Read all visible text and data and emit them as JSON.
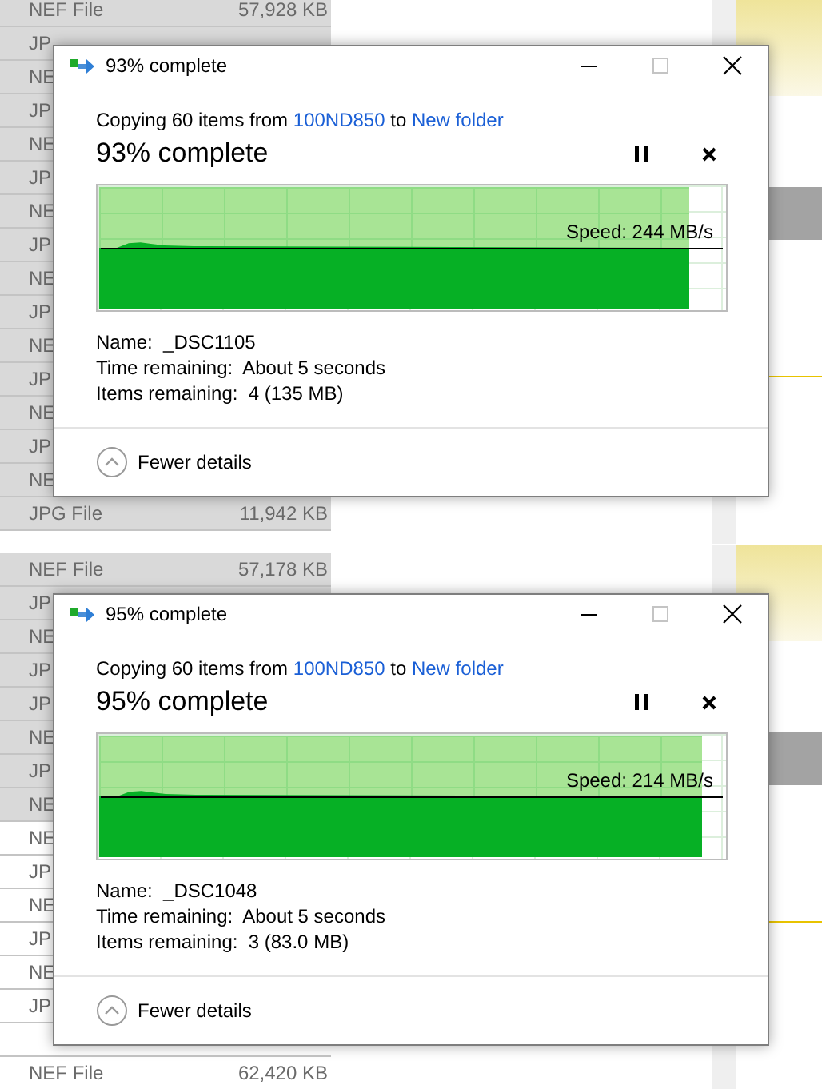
{
  "panels": [
    {
      "explorer": {
        "rows": [
          {
            "type": "NEF File",
            "size": "57,928 KB",
            "selected": true
          },
          {
            "type": "JP",
            "selected": true
          },
          {
            "type": "NE",
            "selected": true
          },
          {
            "type": "JP",
            "selected": true
          },
          {
            "type": "NE",
            "selected": true
          },
          {
            "type": "JP",
            "selected": true
          },
          {
            "type": "NE",
            "selected": true
          },
          {
            "type": "JP",
            "selected": true
          },
          {
            "type": "NE",
            "selected": true
          },
          {
            "type": "JP",
            "selected": true
          },
          {
            "type": "NE",
            "selected": true
          },
          {
            "type": "JP",
            "selected": true
          },
          {
            "type": "NE",
            "selected": true
          },
          {
            "type": "JP",
            "selected": true
          },
          {
            "type": "NE",
            "selected": true
          },
          {
            "type": "JPG File",
            "size": "11,942 KB",
            "selected": true
          }
        ]
      },
      "dialog": {
        "title": "93% complete",
        "message": {
          "prefix": "Copying 60 items from",
          "source": "100ND850",
          "middle": "to",
          "destination": "New folder"
        },
        "heading": "93% complete",
        "level": 0.94,
        "speed": "Speed: 244 MB/s",
        "details": [
          {
            "label": "Name:",
            "value": "_DSC1105"
          },
          {
            "label": "Time remaining:",
            "value": "About 5 seconds"
          },
          {
            "label": "Items remaining:",
            "value": "4 (135 MB)"
          }
        ],
        "toggle": "Fewer details"
      }
    },
    {
      "explorer": {
        "rows": [
          {
            "type": "NEF File",
            "size": "57,178 KB",
            "selected": true
          },
          {
            "type": "JP",
            "selected": true
          },
          {
            "type": "NE",
            "selected": true
          },
          {
            "type": "JP",
            "selected": true
          },
          {
            "type": "JP",
            "selected": true
          },
          {
            "type": "NE",
            "selected": true
          },
          {
            "type": "JP",
            "selected": true
          },
          {
            "type": "NE",
            "selected": true
          },
          {
            "type": "NE",
            "selected": false
          },
          {
            "type": "JP",
            "selected": false
          },
          {
            "type": "NE",
            "selected": false
          },
          {
            "type": "JP",
            "selected": false
          },
          {
            "type": "NE",
            "selected": false
          },
          {
            "type": "JP",
            "selected": false
          },
          {
            "selected": false
          },
          {
            "type": "NEF File",
            "size": "62,420 KB",
            "selected": false
          }
        ]
      },
      "dialog": {
        "title": "95% complete",
        "message": {
          "prefix": "Copying 60 items from",
          "source": "100ND850",
          "middle": "to",
          "destination": "New folder"
        },
        "heading": "95% complete",
        "level": 0.96,
        "speed": "Speed: 214 MB/s",
        "details": [
          {
            "label": "Name:",
            "value": "_DSC1048"
          },
          {
            "label": "Time remaining:",
            "value": "About 5 seconds"
          },
          {
            "label": "Items remaining:",
            "value": "3 (83.0 MB)"
          }
        ],
        "toggle": "Fewer details"
      }
    }
  ]
}
